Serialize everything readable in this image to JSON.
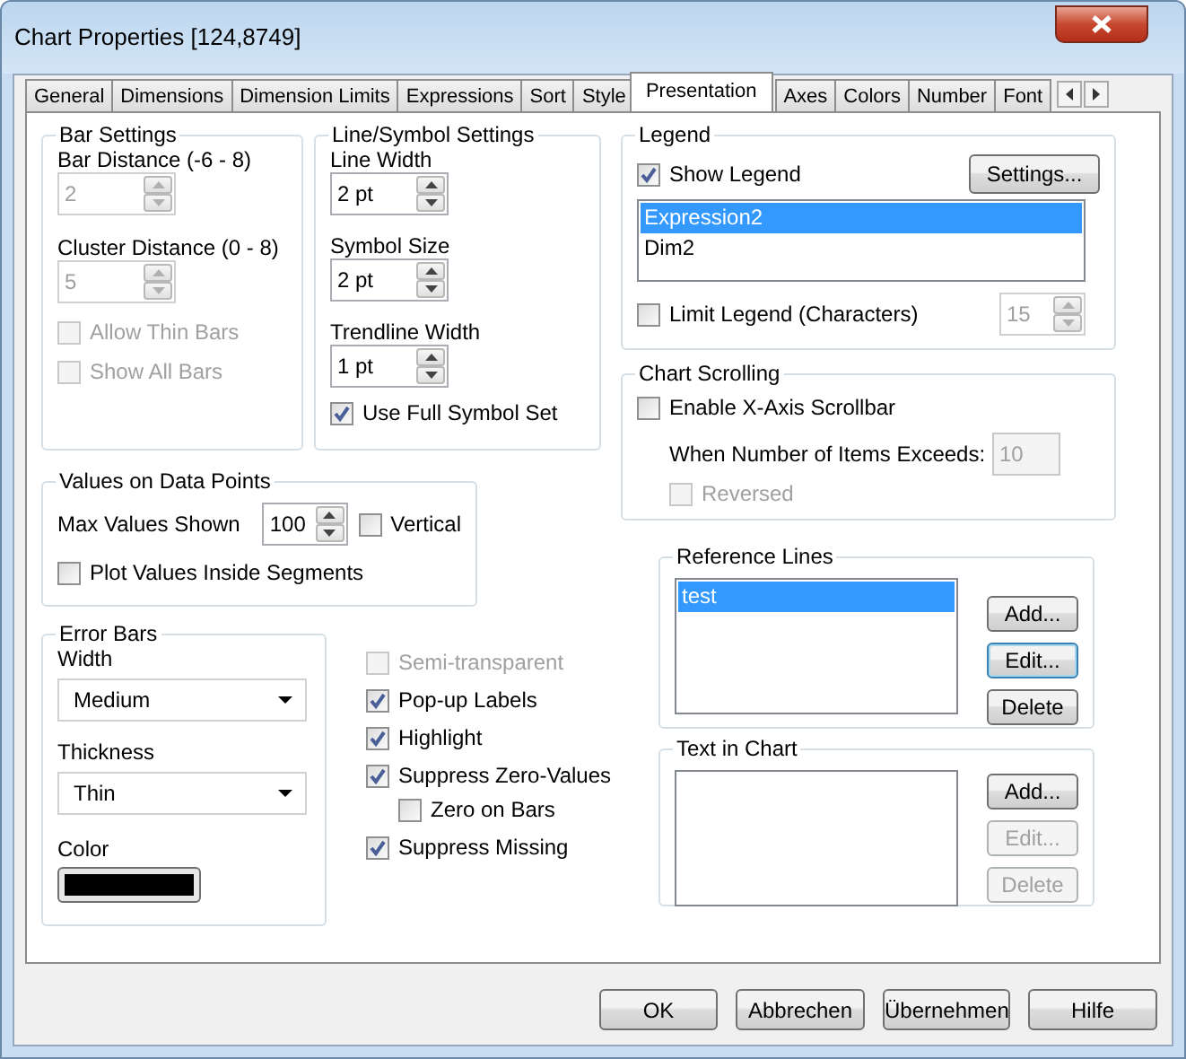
{
  "window": {
    "title": "Chart Properties [124,8749]"
  },
  "tabs": [
    {
      "label": "General",
      "selected": false
    },
    {
      "label": "Dimensions",
      "selected": false
    },
    {
      "label": "Dimension Limits",
      "selected": false
    },
    {
      "label": "Expressions",
      "selected": false
    },
    {
      "label": "Sort",
      "selected": false
    },
    {
      "label": "Style",
      "selected": false
    },
    {
      "label": "Presentation",
      "selected": true
    },
    {
      "label": "Axes",
      "selected": false
    },
    {
      "label": "Colors",
      "selected": false
    },
    {
      "label": "Number",
      "selected": false
    },
    {
      "label": "Font",
      "selected": false
    }
  ],
  "bar_settings": {
    "title": "Bar Settings",
    "fields": [
      {
        "label": "Bar Distance (-6 - 8)",
        "value": "2",
        "disabled": true
      },
      {
        "label": "Cluster Distance (0 - 8)",
        "value": "5",
        "disabled": true
      }
    ],
    "checkboxes": [
      {
        "label": "Allow Thin Bars",
        "checked": false,
        "disabled": true
      },
      {
        "label": "Show All Bars",
        "checked": false,
        "disabled": true
      }
    ]
  },
  "line_symbol_settings": {
    "title": "Line/Symbol Settings",
    "fields": [
      {
        "label": "Line Width",
        "value": "2 pt",
        "disabled": false
      },
      {
        "label": "Symbol Size",
        "value": "2 pt",
        "disabled": false
      },
      {
        "label": "Trendline Width",
        "value": "1 pt",
        "disabled": false
      }
    ],
    "checkboxes": [
      {
        "label": "Use Full Symbol Set",
        "checked": true,
        "disabled": false
      }
    ]
  },
  "values_on_data_points": {
    "title": "Values on Data Points",
    "max_values": {
      "label": "Max Values Shown",
      "value": "100",
      "disabled": false
    },
    "vertical": {
      "label": "Vertical",
      "checked": false,
      "disabled": false
    },
    "plot_inside": {
      "label": "Plot Values Inside Segments",
      "checked": false,
      "disabled": false
    }
  },
  "error_bars": {
    "title": "Error Bars",
    "width": {
      "label": "Width",
      "value": "Medium"
    },
    "thickness": {
      "label": "Thickness",
      "value": "Thin"
    },
    "color": {
      "label": "Color",
      "color": "#000000"
    }
  },
  "options": [
    {
      "label": "Semi-transparent",
      "checked": false,
      "disabled": true
    },
    {
      "label": "Pop-up Labels",
      "checked": true,
      "disabled": false
    },
    {
      "label": "Highlight",
      "checked": true,
      "disabled": false
    },
    {
      "label": "Suppress Zero-Values",
      "checked": true,
      "disabled": false,
      "children": [
        {
          "label": "Zero on Bars",
          "checked": false,
          "disabled": false
        }
      ]
    },
    {
      "label": "Suppress Missing",
      "checked": true,
      "disabled": false
    }
  ],
  "legend": {
    "title": "Legend",
    "show": {
      "label": "Show Legend",
      "checked": true,
      "disabled": false
    },
    "settings_button": "Settings...",
    "items": [
      {
        "label": "Expression2",
        "selected": true
      },
      {
        "label": "Dim2",
        "selected": false
      }
    ],
    "limit": {
      "label": "Limit Legend (Characters)",
      "checked": false,
      "disabled": false
    },
    "limit_value": {
      "value": "15",
      "disabled": true
    }
  },
  "chart_scrolling": {
    "title": "Chart Scrolling",
    "enable": {
      "label": "Enable X-Axis Scrollbar",
      "checked": false,
      "disabled": false
    },
    "threshold": {
      "label": "When Number of Items Exceeds:",
      "value": "10",
      "disabled": true
    },
    "reversed": {
      "label": "Reversed",
      "checked": false,
      "disabled": true
    }
  },
  "reference_lines": {
    "title": "Reference Lines",
    "items": [
      {
        "label": "test",
        "selected": true
      }
    ],
    "buttons": [
      {
        "label": "Add...",
        "disabled": false,
        "focused": false
      },
      {
        "label": "Edit...",
        "disabled": false,
        "focused": true
      },
      {
        "label": "Delete",
        "disabled": false,
        "focused": false
      }
    ]
  },
  "text_in_chart": {
    "title": "Text in Chart",
    "buttons": [
      {
        "label": "Add...",
        "disabled": false,
        "focused": false
      },
      {
        "label": "Edit...",
        "disabled": true,
        "focused": false
      },
      {
        "label": "Delete",
        "disabled": true,
        "focused": false
      }
    ]
  },
  "buttons": [
    {
      "label": "OK"
    },
    {
      "label": "Abbrechen"
    },
    {
      "label": "Übernehmen"
    },
    {
      "label": "Hilfe"
    }
  ]
}
